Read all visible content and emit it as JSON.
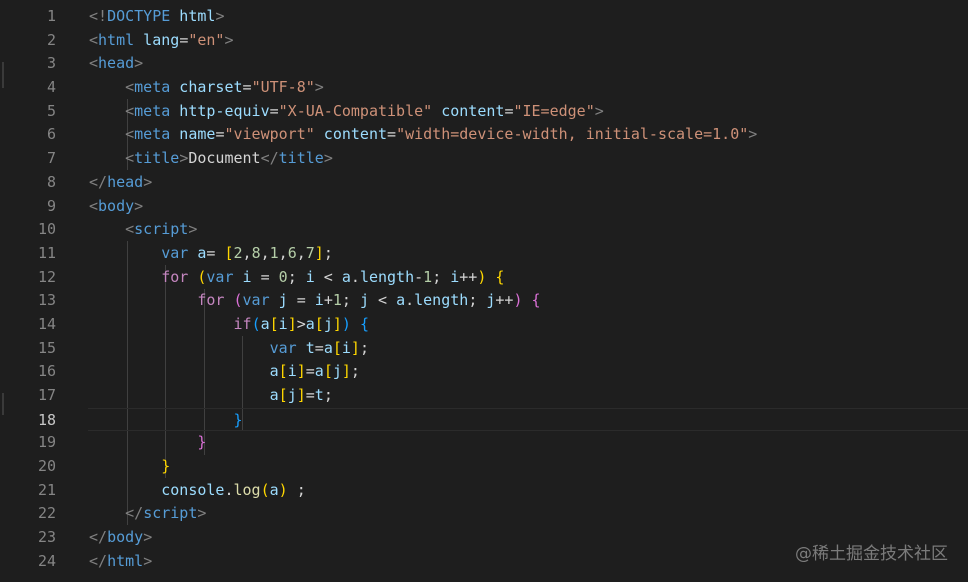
{
  "editor": {
    "active_line": 18,
    "line_numbers": [
      "1",
      "2",
      "3",
      "4",
      "5",
      "6",
      "7",
      "8",
      "9",
      "10",
      "11",
      "12",
      "13",
      "14",
      "15",
      "16",
      "17",
      "18",
      "19",
      "20",
      "21",
      "22",
      "23",
      "24"
    ]
  },
  "code": {
    "l1": {
      "a": "<!",
      "b": "DOCTYPE",
      "c": " html",
      "d": ">"
    },
    "l2": {
      "a": "<",
      "b": "html",
      "c": " lang",
      "d": "=",
      "e": "\"en\"",
      "f": ">"
    },
    "l3": {
      "a": "<",
      "b": "head",
      "c": ">"
    },
    "l4": {
      "i": "    ",
      "a": "<",
      "b": "meta",
      "c": " charset",
      "d": "=",
      "e": "\"UTF-8\"",
      "f": ">"
    },
    "l5": {
      "i": "    ",
      "a": "<",
      "b": "meta",
      "c": " http-equiv",
      "d": "=",
      "e": "\"X-UA-Compatible\"",
      "f": " content",
      "g": "=",
      "h": "\"IE=edge\"",
      "j": ">"
    },
    "l6": {
      "i": "    ",
      "a": "<",
      "b": "meta",
      "c": " name",
      "d": "=",
      "e": "\"viewport\"",
      "f": " content",
      "g": "=",
      "h": "\"width=device-width, initial-scale=1.0\"",
      "j": ">"
    },
    "l7": {
      "i": "    ",
      "a": "<",
      "b": "title",
      "c": ">",
      "d": "Document",
      "e": "</",
      "f": "title",
      "g": ">"
    },
    "l8": {
      "a": "</",
      "b": "head",
      "c": ">"
    },
    "l9": {
      "a": "<",
      "b": "body",
      "c": ">"
    },
    "l10": {
      "i": "    ",
      "a": "<",
      "b": "script",
      "c": ">"
    },
    "l11": {
      "i": "        ",
      "a": "var",
      "b": " a",
      "c": "= ",
      "d": "[",
      "e": "2",
      "f": ",",
      "g": "8",
      "h": ",",
      "j": "1",
      "k": ",",
      "m": "6",
      "n": ",",
      "o": "7",
      "p": "]",
      "q": ";"
    },
    "l12": {
      "i": "        ",
      "a": "for",
      "b": " ",
      "c": "(",
      "d": "var",
      "e": " i",
      "f": " = ",
      "g": "0",
      "h": "; ",
      "j": "i",
      "k": " < ",
      "m": "a",
      "n": ".",
      "o": "length",
      "p": "-",
      "q": "1",
      "r": "; ",
      "s": "i",
      "t": "++",
      "u": ")",
      "v": " ",
      "w": "{"
    },
    "l13": {
      "i": "            ",
      "a": "for",
      "b": " ",
      "c": "(",
      "d": "var",
      "e": " j",
      "f": " = ",
      "g": "i",
      "h": "+",
      "j": "1",
      "k": "; ",
      "m": "j",
      "n": " < ",
      "o": "a",
      "p": ".",
      "q": "length",
      "r": "; ",
      "s": "j",
      "t": "++",
      "u": ")",
      "v": " ",
      "w": "{"
    },
    "l14": {
      "i": "                ",
      "a": "if",
      "b": "(",
      "c": "a",
      "d": "[",
      "e": "i",
      "f": "]",
      "g": ">",
      "h": "a",
      "j": "[",
      "k": "j",
      "m": "]",
      "n": ")",
      "o": " ",
      "p": "{"
    },
    "l15": {
      "i": "                    ",
      "a": "var",
      "b": " t",
      "c": "=",
      "d": "a",
      "e": "[",
      "f": "i",
      "g": "]",
      "h": ";"
    },
    "l16": {
      "i": "                    ",
      "a": "a",
      "b": "[",
      "c": "i",
      "d": "]",
      "e": "=",
      "f": "a",
      "g": "[",
      "h": "j",
      "j": "]",
      "k": ";"
    },
    "l17": {
      "i": "                    ",
      "a": "a",
      "b": "[",
      "c": "j",
      "d": "]",
      "e": "=",
      "f": "t",
      "g": ";"
    },
    "l18": {
      "i": "                ",
      "a": "}"
    },
    "l19": {
      "i": "            ",
      "a": "}"
    },
    "l20": {
      "i": "        ",
      "a": "}"
    },
    "l21": {
      "i": "        ",
      "a": "console",
      "b": ".",
      "c": "log",
      "d": "(",
      "e": "a",
      "f": ")",
      "g": " ;"
    },
    "l22": {
      "i": "    ",
      "a": "</",
      "b": "script",
      "c": ">"
    },
    "l23": {
      "a": "</",
      "b": "body",
      "c": ">"
    },
    "l24": {
      "a": "</",
      "b": "html",
      "c": ">"
    }
  },
  "watermark": "@稀土掘金技术社区",
  "colors": {
    "background": "#1e1e1e",
    "line_number": "#858585",
    "tag": "#569cd6",
    "attribute": "#9cdcfe",
    "string": "#ce9178",
    "control_keyword": "#c586c0",
    "number": "#b5cea8",
    "function": "#dcdcaa",
    "bracket_level1": "#ffd700",
    "bracket_level2": "#da70d6",
    "bracket_level3": "#179fff"
  }
}
